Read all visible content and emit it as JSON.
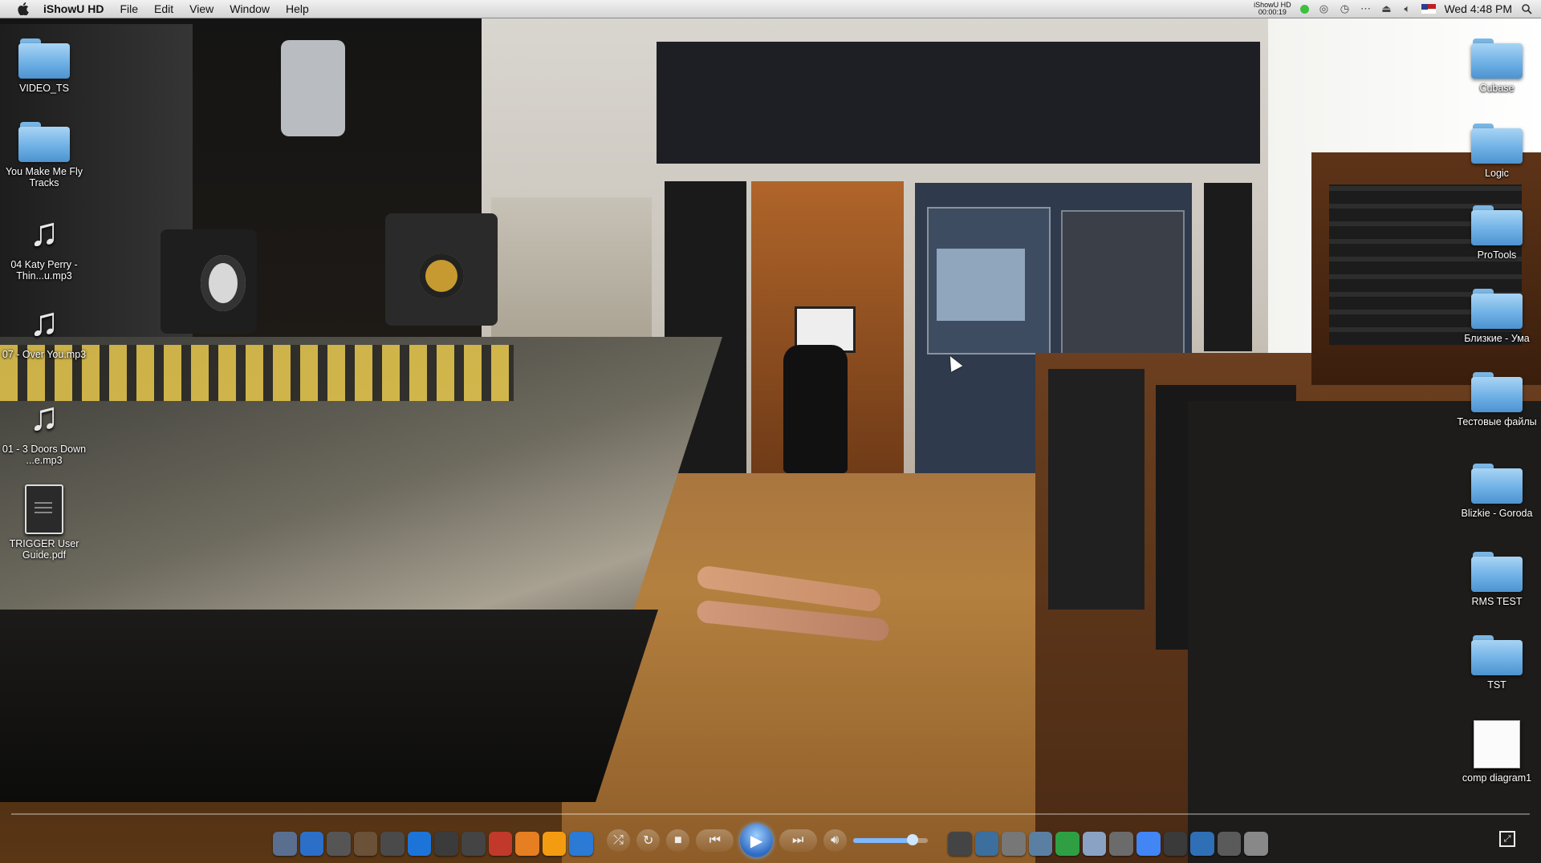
{
  "menubar": {
    "app_name": "iShowU HD",
    "menus": [
      "File",
      "Edit",
      "View",
      "Window",
      "Help"
    ],
    "recorder_label": "iShowU HD",
    "recorder_time": "00:00:19",
    "clock": "Wed 4:48 PM",
    "status_color": "#3fbf3f"
  },
  "desktop_left": [
    {
      "label": "VIDEO_TS",
      "kind": "folder"
    },
    {
      "label": "You Make Me Fly Tracks",
      "kind": "folder"
    },
    {
      "label": "04  Katy Perry - Thin...u.mp3",
      "kind": "music"
    },
    {
      "label": "07 - Over You.mp3",
      "kind": "music"
    },
    {
      "label": "01 - 3 Doors Down ...e.mp3",
      "kind": "music"
    },
    {
      "label": "TRIGGER User Guide.pdf",
      "kind": "pdf"
    }
  ],
  "desktop_right": [
    {
      "label": "Cubase",
      "kind": "folder"
    },
    {
      "label": "Logic",
      "kind": "folder"
    },
    {
      "label": "ProTools",
      "kind": "folder"
    },
    {
      "label": "Близкие - Ума",
      "kind": "folder"
    },
    {
      "label": "Тестовые файлы",
      "kind": "folder"
    },
    {
      "label": "Blizkie - Goroda",
      "kind": "folder"
    },
    {
      "label": "RMS TEST",
      "kind": "folder"
    },
    {
      "label": "TST",
      "kind": "folder"
    },
    {
      "label": "comp diagram1",
      "kind": "doc"
    }
  ],
  "player": {
    "volume": 0.8,
    "accent": "#2f6bc4"
  },
  "dock_colors": [
    "#5a6f8f",
    "#2b6fc8",
    "#555",
    "#6a5138",
    "#4a4a4a",
    "#1d74d8",
    "#3b3b3b",
    "#444",
    "#c0392b",
    "#e67e22",
    "#f39c12",
    "#2a7ad6",
    "#444",
    "#3c6e9e",
    "#777",
    "#5b7fa3",
    "#2ea043",
    "#8aa3c4",
    "#6b6b6b",
    "#4285f4",
    "#3a3a3a",
    "#2f6fb5",
    "#5a5a5a",
    "#888"
  ]
}
